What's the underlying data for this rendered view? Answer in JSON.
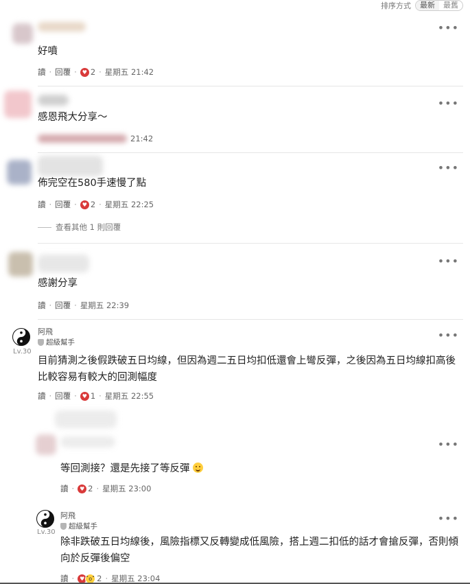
{
  "sort": {
    "label": "排序方式",
    "options": [
      "最新",
      "最舊"
    ],
    "selected": 0
  },
  "comments": [
    {
      "text": "好噴",
      "read": "讀",
      "reply": "回覆",
      "likes": "2",
      "time": "星期五 21:42"
    },
    {
      "text": "感恩飛大分享～",
      "time": "21:42"
    },
    {
      "text": "佈完空在580手速慢了點",
      "read": "讀",
      "reply": "回覆",
      "likes": "2",
      "time": "星期五 22:25",
      "view_more": "查看其他 1 則回覆"
    },
    {
      "text": "感謝分享",
      "read": "讀",
      "reply": "回覆",
      "time": "星期五 22:39"
    },
    {
      "user": "阿飛",
      "level": "Lv.30",
      "badge": "超級幫手",
      "text": "目前猜測之後假跌破五日均線，但因為週二五日均扣低還會上彎反彈，之後因為五日均線扣高後比較容易有較大的回測幅度",
      "read": "讀",
      "reply": "回覆",
      "likes": "1",
      "time": "星期五 22:55"
    },
    {
      "text": "等回測接？還是先接了等反彈",
      "read": "讀",
      "likes": "2",
      "time": "星期五 23:00"
    },
    {
      "user": "阿飛",
      "level": "Lv.30",
      "badge": "超級幫手",
      "text": "除非跌破五日均線後，風險指標又反轉變成低風險，搭上週二扣低的話才會搶反彈，否則傾向於反彈後偏空",
      "read": "讀",
      "likes": "2",
      "time": "星期五 23:04"
    }
  ],
  "icons": {
    "more": "more-dots-icon",
    "like": "heart-like-icon",
    "wow": "wow-face-icon",
    "badge": "shield-badge-icon",
    "avatar": "yin-yang-avatar-icon"
  },
  "colors": {
    "like": "#d93a3a",
    "wow": "#ffcf3a",
    "text": "#222222",
    "meta": "#666666"
  }
}
